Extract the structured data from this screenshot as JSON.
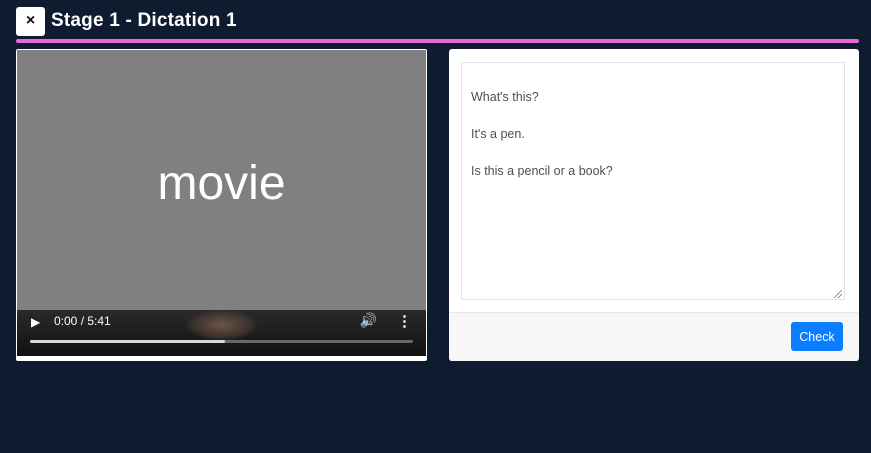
{
  "header": {
    "close_label": "×",
    "title": "Stage 1 - Dictation 1"
  },
  "video": {
    "placeholder_text": "movie",
    "time": "0:00 / 5:41",
    "progress_fraction": 0.51,
    "icons": [
      "play-icon",
      "volume-icon",
      "more-vert-icon"
    ]
  },
  "dictation": {
    "lines": [
      "What's this?",
      "It's a pen.",
      "Is this a pencil or a book?"
    ],
    "check_label": "Check"
  },
  "colors": {
    "background": "#0f1b2e",
    "accent": "#e667d8",
    "check_button": "#0b7dff",
    "video_bg": "#808080"
  }
}
